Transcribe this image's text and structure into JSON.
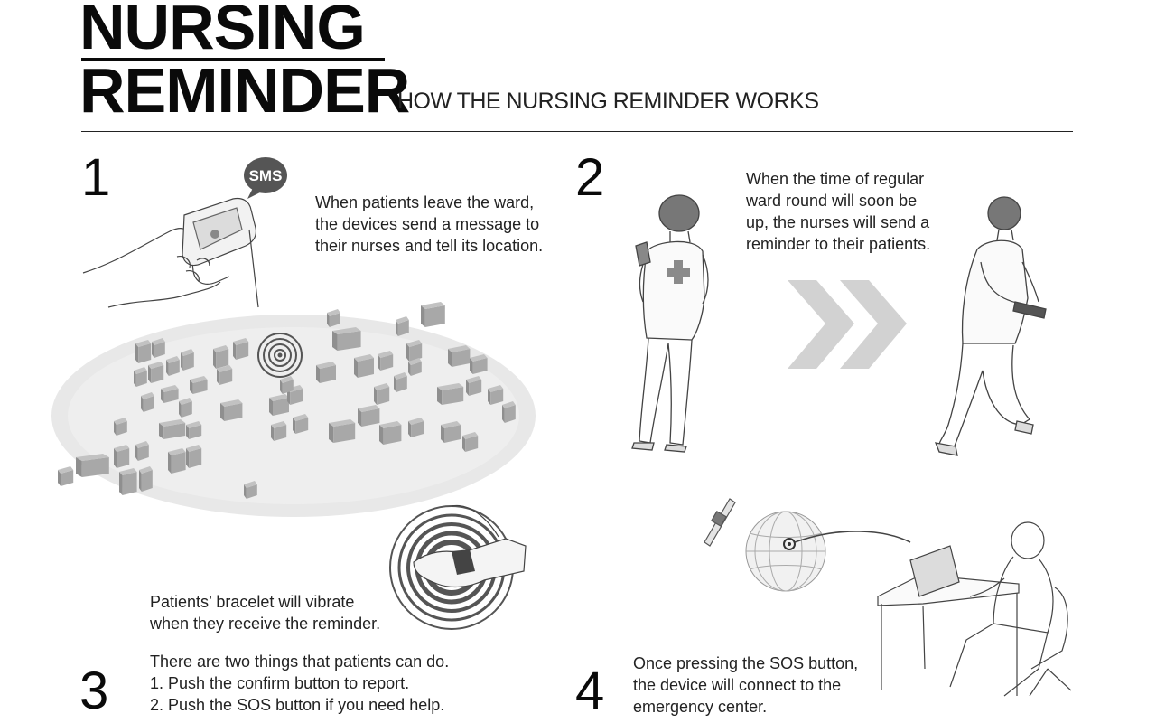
{
  "header": {
    "title_line1": "NURSING",
    "title_line2": "REMINDER",
    "subtitle": "HOW THE NURSING REMINDER WORKS"
  },
  "steps": [
    {
      "number": "1",
      "badge": "SMS",
      "lines": [
        "When patients leave the ward,",
        "the devices send a message to",
        "their nurses and tell its location."
      ]
    },
    {
      "number": "2",
      "lines": [
        "When the time of regular",
        "ward round will soon be",
        "up, the nurses will send a",
        "reminder to their patients."
      ]
    },
    {
      "number": "3",
      "vibrate_lines": [
        "Patients’ bracelet will vibrate",
        "when they receive the reminder."
      ],
      "lines": [
        "There are two things that patients can do.",
        "1. Push the confirm button to report.",
        "2. Push the SOS button if you need help."
      ]
    },
    {
      "number": "4",
      "lines": [
        "Once pressing the SOS button,",
        "the device will connect to the",
        "emergency center."
      ]
    }
  ],
  "colors": {
    "ink": "#0a0a0a",
    "building": "#9a9a9a",
    "map_shadow": "#e6e6e6",
    "arrow": "#d2d2d2",
    "sms_bubble": "#555555"
  }
}
